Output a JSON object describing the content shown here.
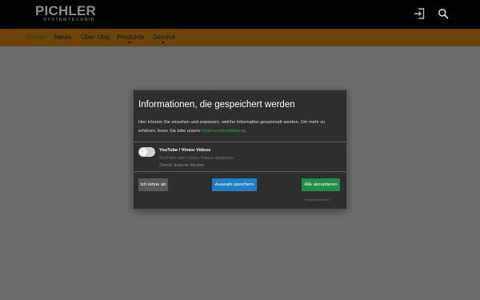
{
  "header": {
    "logo_text": "PICHLER",
    "logo_subtitle": "SYSTEMTECHNIK",
    "icons": {
      "login": "login-icon",
      "search": "search-icon"
    }
  },
  "nav": {
    "items": [
      {
        "label": "Home",
        "active": true
      },
      {
        "label": "News"
      },
      {
        "label": "Über Uns"
      },
      {
        "label": "Produkte",
        "has_submenu": true
      },
      {
        "label": "Service",
        "has_submenu": true
      }
    ]
  },
  "consent": {
    "title": "Informationen, die gespeichert werden",
    "description_prefix": "Hier können Sie einsehen und anpassen, welche Information gesammelt werden. Um mehr zu erfahren, lesen Sie bitte unsere",
    "description_link": "Datenschutzerklärung",
    "description_suffix": ".",
    "service": {
      "name": "YouTube / Vimeo Videos",
      "description": "YouTube oder Vimeo Videos abspielen",
      "purpose": "Zweck: Externe Medien",
      "enabled": false
    },
    "buttons": {
      "decline": "Ich lehne ab",
      "save": "Auswahl speichern",
      "accept_all": "Alle akzeptieren"
    },
    "powered_by": "Realisiert mit Klaro!"
  },
  "colors": {
    "nav_bar": "#6b4408",
    "accept": "#1f8e4a",
    "save": "#1e7fc6",
    "link": "#2fa34a"
  }
}
